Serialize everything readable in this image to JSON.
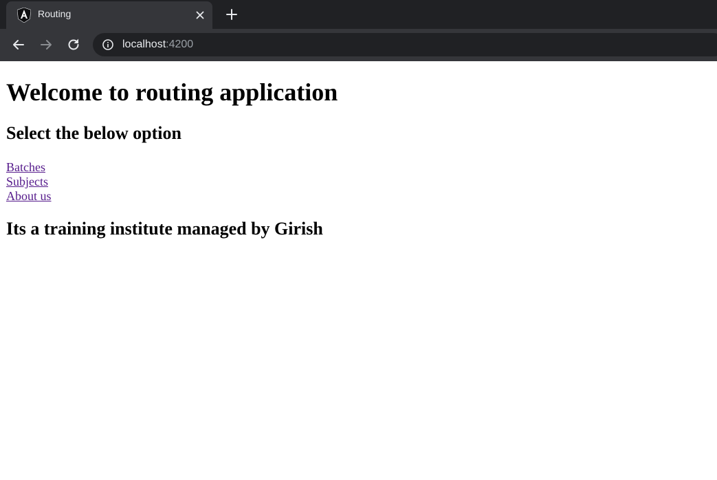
{
  "browser": {
    "tab": {
      "title": "Routing",
      "favicon": "angular-logo-icon"
    },
    "address_bar": {
      "host": "localhost",
      "port": ":4200"
    },
    "colors": {
      "chrome_background": "#35363a",
      "tab_strip": "#202124",
      "omnibox": "#202124",
      "visited_link": "#551a8b"
    }
  },
  "page": {
    "title": "Welcome to routing application",
    "subtitle": "Select the below option",
    "links": [
      {
        "label": "Batches"
      },
      {
        "label": "Subjects"
      },
      {
        "label": "About us"
      }
    ],
    "footer": "Its a training institute managed by Girish"
  }
}
